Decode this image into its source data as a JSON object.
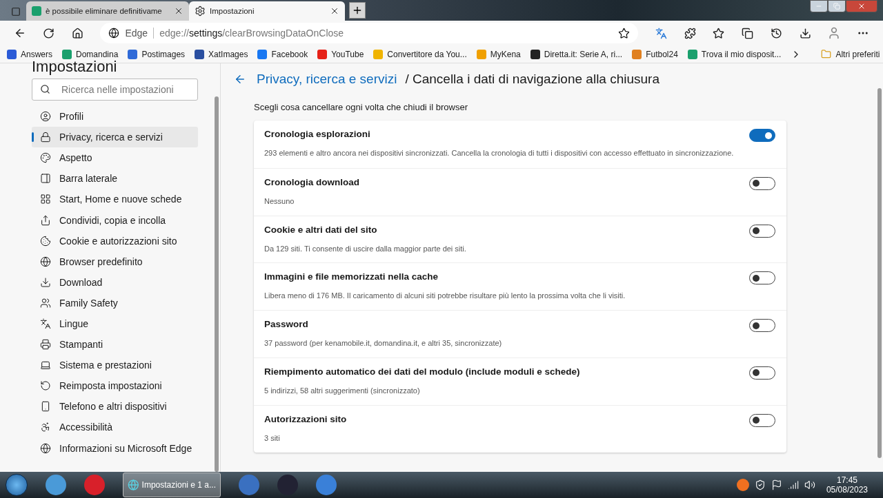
{
  "tabs": [
    {
      "title": "è possibile eliminare definitivame",
      "selected": false
    },
    {
      "title": "Impostazioni",
      "selected": true
    }
  ],
  "address": {
    "brand": "Edge",
    "scheme": "edge://",
    "host": "settings",
    "path": "/clearBrowsingDataOnClose"
  },
  "favorites": [
    {
      "label": "Answers"
    },
    {
      "label": "Domandina"
    },
    {
      "label": "Postimages"
    },
    {
      "label": "XatImages"
    },
    {
      "label": "Facebook"
    },
    {
      "label": "YouTube"
    },
    {
      "label": "Convertitore da You..."
    },
    {
      "label": "MyKena"
    },
    {
      "label": "Diretta.it: Serie A, ri..."
    },
    {
      "label": "Futbol24"
    },
    {
      "label": "Trova il mio disposit..."
    }
  ],
  "other_favorites": "Altri preferiti",
  "sidebar": {
    "title": "Impostazioni",
    "search_placeholder": "Ricerca nelle impostazioni",
    "items": [
      {
        "label": "Profili",
        "selected": false
      },
      {
        "label": "Privacy, ricerca e servizi",
        "selected": true
      },
      {
        "label": "Aspetto",
        "selected": false
      },
      {
        "label": "Barra laterale",
        "selected": false
      },
      {
        "label": "Start, Home e nuove schede",
        "selected": false
      },
      {
        "label": "Condividi, copia e incolla",
        "selected": false
      },
      {
        "label": "Cookie e autorizzazioni sito",
        "selected": false
      },
      {
        "label": "Browser predefinito",
        "selected": false
      },
      {
        "label": "Download",
        "selected": false
      },
      {
        "label": "Family Safety",
        "selected": false
      },
      {
        "label": "Lingue",
        "selected": false
      },
      {
        "label": "Stampanti",
        "selected": false
      },
      {
        "label": "Sistema e prestazioni",
        "selected": false
      },
      {
        "label": "Reimposta impostazioni",
        "selected": false
      },
      {
        "label": "Telefono e altri dispositivi",
        "selected": false
      },
      {
        "label": "Accessibilità",
        "selected": false
      },
      {
        "label": "Informazioni su Microsoft Edge",
        "selected": false
      }
    ]
  },
  "page": {
    "breadcrumb": "Privacy, ricerca e servizi",
    "title": "/ Cancella i dati di navigazione alla chiusura",
    "intro": "Scegli cosa cancellare ogni volta che chiudi il browser",
    "options": [
      {
        "label": "Cronologia esplorazioni",
        "detail": "293 elementi e altro ancora nei dispositivi sincronizzati. Cancella la cronologia di tutti i dispositivi con accesso effettuato in sincronizzazione.",
        "on": true
      },
      {
        "label": "Cronologia download",
        "detail": "Nessuno",
        "on": false
      },
      {
        "label": "Cookie e altri dati del sito",
        "detail": "Da 129 siti. Ti consente di uscire dalla maggior parte dei siti.",
        "on": false
      },
      {
        "label": "Immagini e file memorizzati nella cache",
        "detail": "Libera meno di 176 MB. Il caricamento di alcuni siti potrebbe risultare più lento la prossima volta che li visiti.",
        "on": false
      },
      {
        "label": "Password",
        "detail": "37 password (per kenamobile.it, domandina.it, e altri 35, sincronizzate)",
        "on": false
      },
      {
        "label": "Riempimento automatico dei dati del modulo (include moduli e schede)",
        "detail": "5 indirizzi, 58 altri suggerimenti (sincronizzato)",
        "on": false
      },
      {
        "label": "Autorizzazioni sito",
        "detail": "3 siti",
        "on": false
      }
    ]
  },
  "taskbar": {
    "window_label": "Impostazioni e 1 a...",
    "time": "17:45",
    "date": "05/08/2023"
  }
}
